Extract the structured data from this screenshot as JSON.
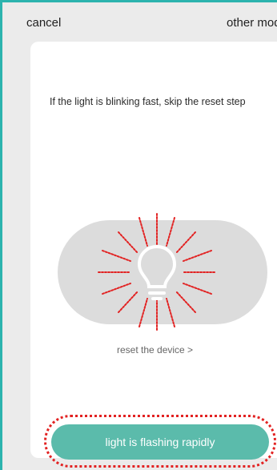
{
  "header": {
    "cancel_label": "cancel",
    "other_mode_label": "other mod"
  },
  "main": {
    "instruction": "If the light is blinking fast, skip the reset step",
    "reset_link": "reset the device >",
    "primary_button": "light is flashing rapidly",
    "bulb_icon": "lightbulb-icon"
  },
  "colors": {
    "accent": "#2cb3ae",
    "button": "#5bbbab",
    "highlight": "#e22222"
  }
}
